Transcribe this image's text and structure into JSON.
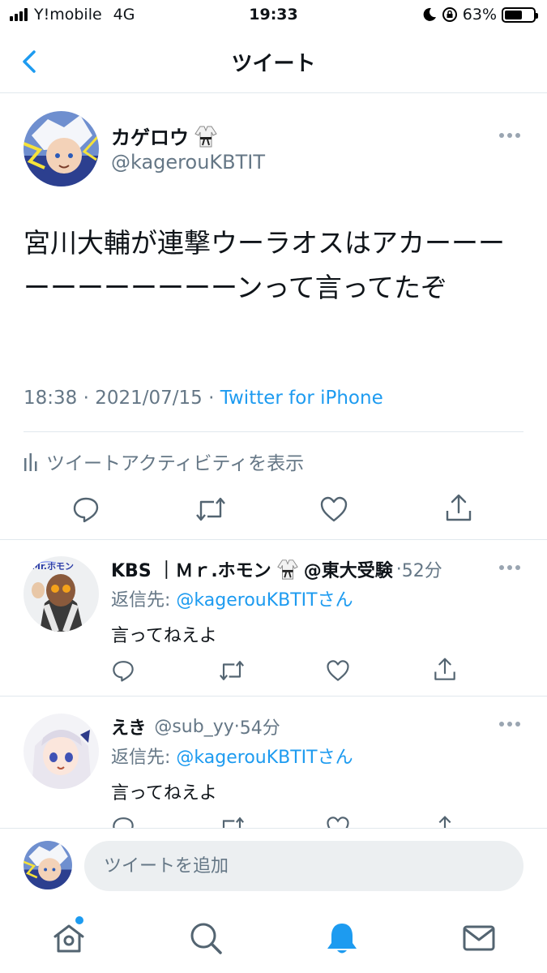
{
  "status_bar": {
    "carrier": "Y!mobile",
    "network": "4G",
    "time": "19:33",
    "battery": "63%",
    "battery_level": 0.63
  },
  "header": {
    "title": "ツイート"
  },
  "tweet": {
    "author_name": "カゲロウ",
    "author_handle": "@kagerouKBTIT",
    "text": "宮川大輔が連撃ウーラオスはアカーーーーーーーーーーーンって言ってたぞ",
    "time": "18:38",
    "date": "2021/07/15",
    "separator": "·",
    "source": "Twitter for iPhone",
    "activity_label": "ツイートアクティビティを表示"
  },
  "replies": [
    {
      "name": "KBS ｜Ｍｒ.ホモン",
      "handle": "@東大受験",
      "time": "52分",
      "replying_prefix": "返信先:",
      "replying_to": "@kagerouKBTITさん",
      "text": "言ってねえよ"
    },
    {
      "name": "えき",
      "handle": "@sub_yy",
      "time": "54分",
      "replying_prefix": "返信先:",
      "replying_to": "@kagerouKBTITさん",
      "text": "言ってねえよ"
    }
  ],
  "composer": {
    "placeholder": "ツイートを追加"
  },
  "colors": {
    "accent": "#1d9bf0",
    "secondary_text": "#657786",
    "divider": "#e1e8ed"
  },
  "icons": {
    "tabs": [
      "home-icon",
      "search-icon",
      "notifications-icon",
      "messages-icon"
    ],
    "actions": [
      "reply-icon",
      "retweet-icon",
      "like-icon",
      "share-icon"
    ]
  }
}
